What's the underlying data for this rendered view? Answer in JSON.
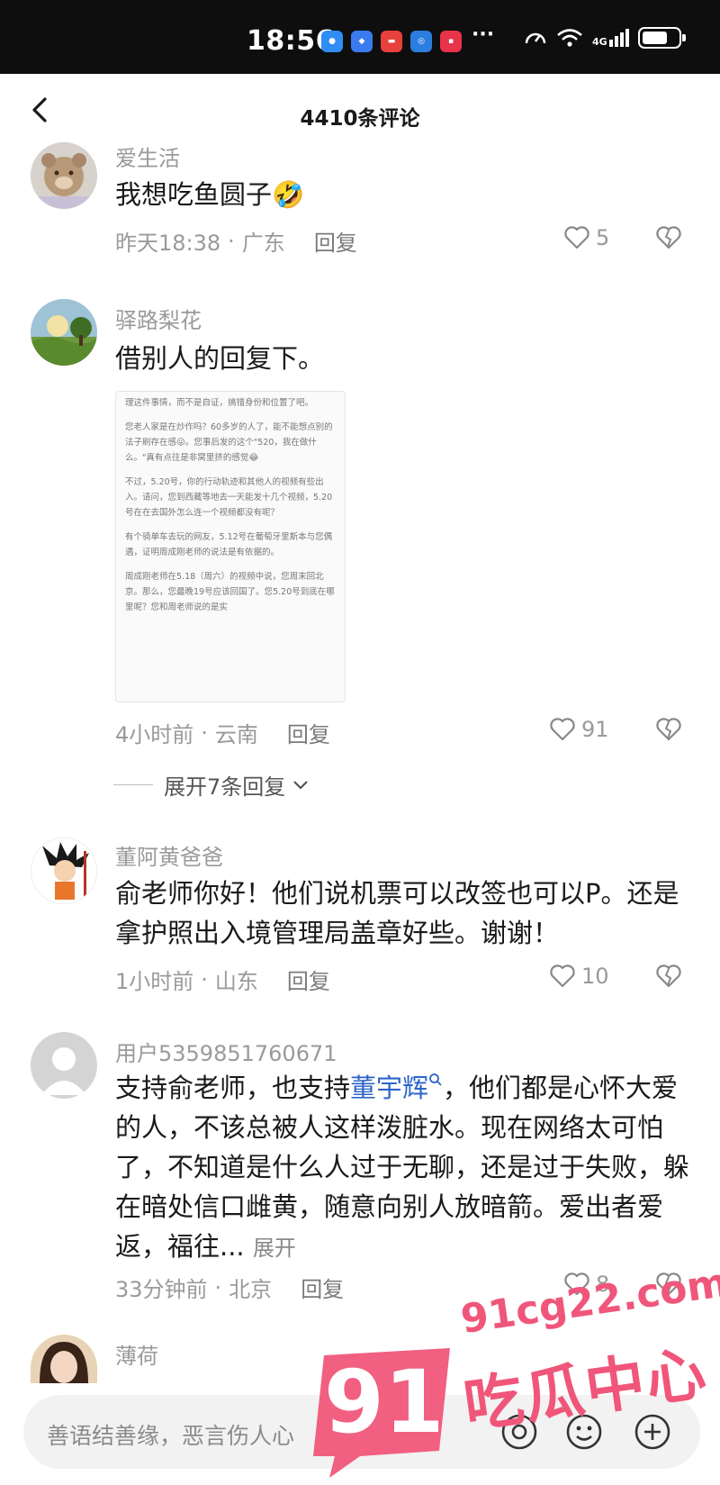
{
  "status_bar": {
    "time": "18:56",
    "network": "4G",
    "battery_level": 0.72,
    "more": "···"
  },
  "header": {
    "title": "4410条评论"
  },
  "comments": [
    {
      "user": "爱生活",
      "text": "我想吃鱼圆子🤣",
      "time": "昨天18:38",
      "location": "广东",
      "reply": "回复",
      "likes": "5"
    },
    {
      "user": "驿路梨花",
      "text": "借别人的回复下。",
      "screenshot_lines": [
        "理这件事情，而不是自证，搞错身份和位置了吧。",
        "您老人家是在炒作吗？60多岁的人了，能不能想点别的法子刷存在感😜。您事后发的这个\"520，我在做什么。\"真有点往是非窝里挤的感觉😂",
        "不过，5.20号，你的行动轨迹和其他人的视频有些出入。请问，您到西藏等地去一天能发十几个视频，5.20号在在去国外怎么连一个视频都没有呢？",
        "有个骑单车去玩的网友，5.12号在葡萄牙里斯本与您偶遇，证明周成刚老师的说法是有依据的。",
        "周成刚老师在5.18（周六）的视频中说，您周末回北京。那么，您最晚19号应该回国了。您5.20号到底在哪里呢？您和周老师说的是实"
      ],
      "time": "4小时前",
      "location": "云南",
      "reply": "回复",
      "likes": "91",
      "expand_replies": "展开7条回复"
    },
    {
      "user": "董阿黄爸爸",
      "text": "俞老师你好！他们说机票可以改签也可以P。还是拿护照出入境管理局盖章好些。谢谢！",
      "time": "1小时前",
      "location": "山东",
      "reply": "回复",
      "likes": "10"
    },
    {
      "user": "用户5359851760671",
      "text_before": "支持俞老师，也支持",
      "mention": "董宇辉",
      "text_after": "，他们都是心怀大爱的人，不该总被人这样泼脏水。现在网络太可怕了，不知道是什么人过于无聊，还是过于失败，躲在暗处信口雌黄，随意向别人放暗箭。爱出者爱返，福往...",
      "expand": "展开",
      "time": "33分钟前",
      "location": "北京",
      "reply": "回复",
      "likes": "8"
    },
    {
      "user": "薄荷"
    }
  ],
  "input": {
    "placeholder": "善语结善缘，恶言伤人心"
  },
  "watermark": {
    "brand": "91",
    "site": "91cg22.com",
    "name": "吃瓜中心"
  },
  "colors": {
    "mention": "#2e65c9",
    "watermark": "#f0567a"
  }
}
